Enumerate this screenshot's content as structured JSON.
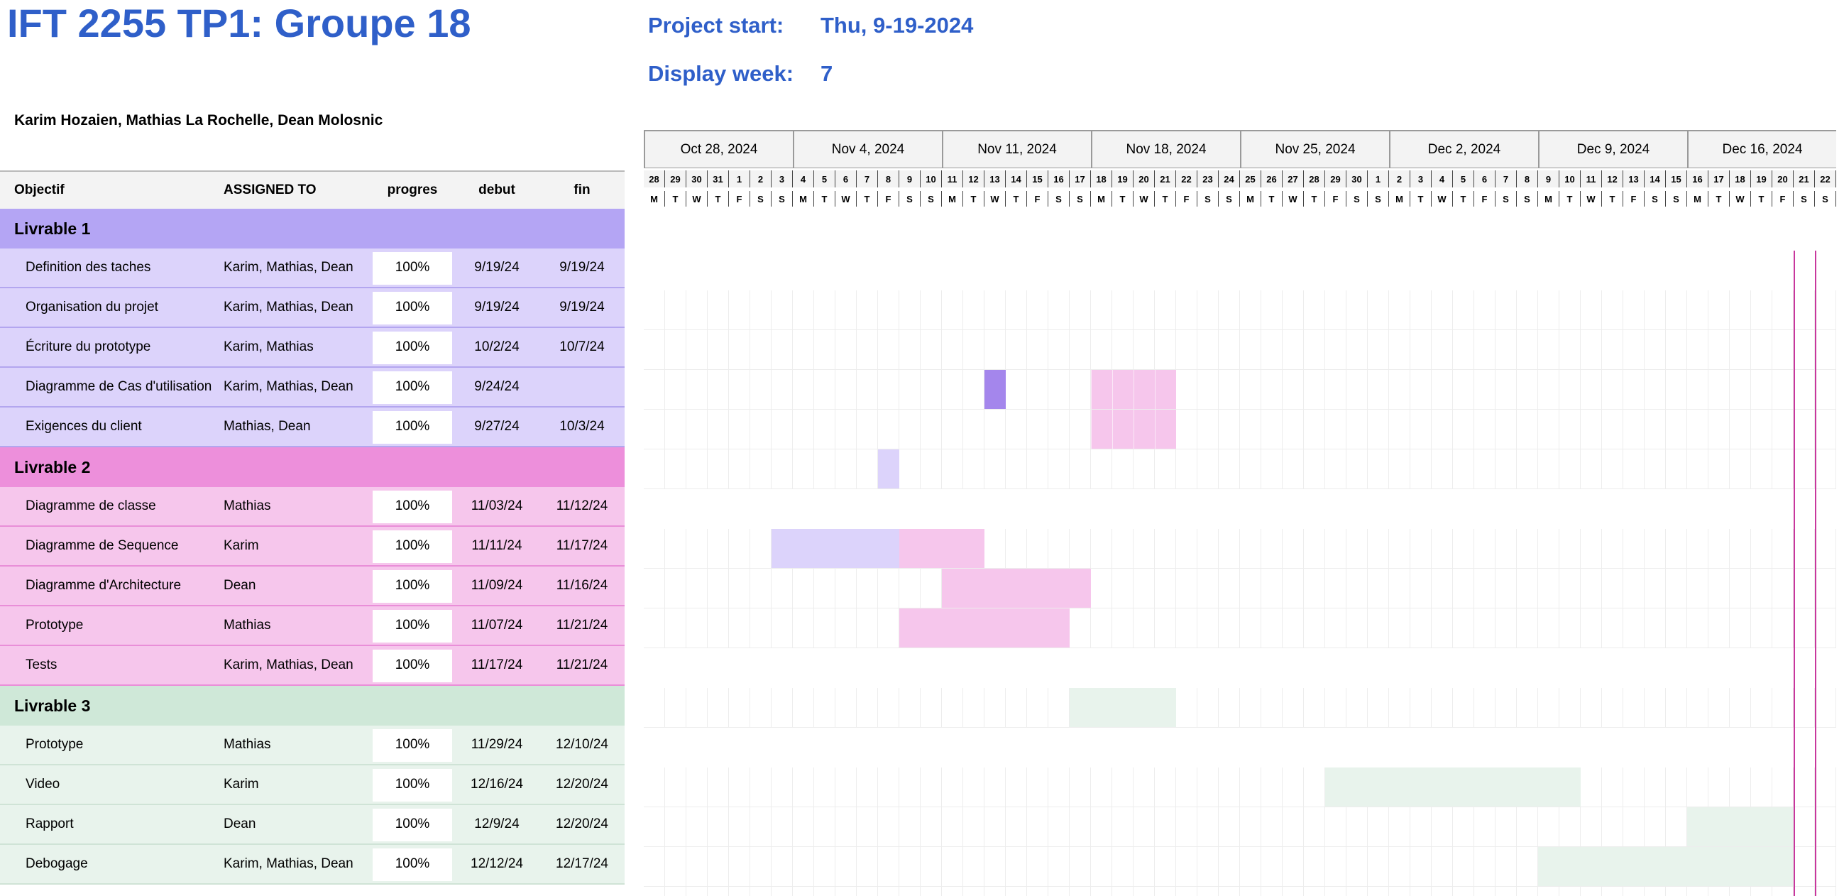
{
  "header": {
    "title": "IFT 2255 TP1: Groupe 18",
    "project_start_label": "Project start:",
    "project_start_value": "Thu, 9-19-2024",
    "display_week_label": "Display week:",
    "display_week_value": "7",
    "team": "Karim Hozaien, Mathias La Rochelle, Dean Molosnic"
  },
  "table": {
    "columns": [
      "Objectif",
      "ASSIGNED TO",
      "progres",
      "debut",
      "fin"
    ],
    "sections": [
      {
        "name": "Livrable 1",
        "header_color": "#b4a5f4",
        "row_color": "#dcd3fb",
        "line_color": "#b3a6ef",
        "tasks": [
          {
            "name": "Definition des taches",
            "assigned": "Karim, Mathias, Dean",
            "progress": "100%",
            "start": "9/19/24",
            "end": "9/19/24"
          },
          {
            "name": "Organisation du projet",
            "assigned": "Karim, Mathias, Dean",
            "progress": "100%",
            "start": "9/19/24",
            "end": "9/19/24"
          },
          {
            "name": "Écriture du prototype",
            "assigned": "Karim, Mathias",
            "progress": "100%",
            "start": "10/2/24",
            "end": "10/7/24"
          },
          {
            "name": "Diagramme de Cas d'utilisation",
            "assigned": "Karim, Mathias, Dean",
            "progress": "100%",
            "start": "9/24/24",
            "end": ""
          },
          {
            "name": "Exigences du client",
            "assigned": "Mathias, Dean",
            "progress": "100%",
            "start": "9/27/24",
            "end": "10/3/24"
          }
        ]
      },
      {
        "name": "Livrable 2",
        "header_color": "#ed8fdb",
        "row_color": "#f6c6ec",
        "line_color": "#e98ed8",
        "tasks": [
          {
            "name": "Diagramme de classe",
            "assigned": "Mathias",
            "progress": "100%",
            "start": "11/03/24",
            "end": "11/12/24"
          },
          {
            "name": "Diagramme de Sequence",
            "assigned": "Karim",
            "progress": "100%",
            "start": "11/11/24",
            "end": "11/17/24"
          },
          {
            "name": "Diagramme d'Architecture",
            "assigned": "Dean",
            "progress": "100%",
            "start": "11/09/24",
            "end": "11/16/24"
          },
          {
            "name": "Prototype",
            "assigned": "Mathias",
            "progress": "100%",
            "start": "11/07/24",
            "end": "11/21/24"
          },
          {
            "name": "Tests",
            "assigned": "Karim, Mathias, Dean",
            "progress": "100%",
            "start": "11/17/24",
            "end": "11/21/24"
          }
        ]
      },
      {
        "name": "Livrable 3",
        "header_color": "#cfe8d8",
        "row_color": "#e8f3ec",
        "line_color": "#cfe3d6",
        "tasks": [
          {
            "name": "Prototype",
            "assigned": "Mathias",
            "progress": "100%",
            "start": "11/29/24",
            "end": "12/10/24"
          },
          {
            "name": "Video",
            "assigned": "Karim",
            "progress": "100%",
            "start": "12/16/24",
            "end": "12/20/24"
          },
          {
            "name": "Rapport",
            "assigned": "Dean",
            "progress": "100%",
            "start": "12/9/24",
            "end": "12/20/24"
          },
          {
            "name": "Debogage",
            "assigned": "Karim, Mathias, Dean",
            "progress": "100%",
            "start": "12/12/24",
            "end": "12/17/24"
          }
        ]
      }
    ]
  },
  "gantt": {
    "weeks": [
      "Oct 28, 2024",
      "Nov 4, 2024",
      "Nov 11, 2024",
      "Nov 18, 2024",
      "Nov 25, 2024",
      "Dec 2, 2024",
      "Dec 9, 2024",
      "Dec 16, 2024"
    ],
    "days": [
      "28",
      "29",
      "30",
      "31",
      "1",
      "2",
      "3",
      "4",
      "5",
      "6",
      "7",
      "8",
      "9",
      "10",
      "11",
      "12",
      "13",
      "14",
      "15",
      "16",
      "17",
      "18",
      "19",
      "20",
      "21",
      "22",
      "23",
      "24",
      "25",
      "26",
      "27",
      "28",
      "29",
      "30",
      "1",
      "2",
      "3",
      "4",
      "5",
      "6",
      "7",
      "8",
      "9",
      "10",
      "11",
      "12",
      "13",
      "14",
      "15",
      "16",
      "17",
      "18",
      "19",
      "20",
      "21",
      "22"
    ],
    "weekdays": [
      "M",
      "T",
      "W",
      "T",
      "F",
      "S",
      "S"
    ],
    "first_day": "2024-10-28",
    "today_day": 54,
    "today_color": "#c8379d",
    "bars": [
      {
        "row": 3,
        "from": 16,
        "to": 16,
        "color": "#a486ec"
      },
      {
        "row": 3,
        "from": 21,
        "to": 24,
        "color": "#f6c6ec",
        "cellborders": true
      },
      {
        "row": 4,
        "from": 21,
        "to": 24,
        "color": "#f6c6ec",
        "cellborders": true
      },
      {
        "row": 5,
        "from": 11,
        "to": 11,
        "color": "#dcd3fb"
      },
      {
        "row": 7,
        "from": 6,
        "to": 11,
        "color": "#dcd3fb"
      },
      {
        "row": 7,
        "from": 12,
        "to": 15,
        "color": "#f6c6ec"
      },
      {
        "row": 8,
        "from": 14,
        "to": 20,
        "color": "#f6c6ec"
      },
      {
        "row": 9,
        "from": 12,
        "to": 19,
        "color": "#f6c6ec"
      },
      {
        "row": 11,
        "from": 20,
        "to": 24,
        "color": "#e8f3ec"
      },
      {
        "row": 13,
        "from": 32,
        "to": 43,
        "color": "#e8f3ec"
      },
      {
        "row": 14,
        "from": 49,
        "to": 53,
        "color": "#e8f3ec"
      },
      {
        "row": 15,
        "from": 42,
        "to": 53,
        "color": "#e8f3ec"
      }
    ],
    "gap_rows": [
      0,
      6,
      10,
      12,
      17
    ]
  }
}
